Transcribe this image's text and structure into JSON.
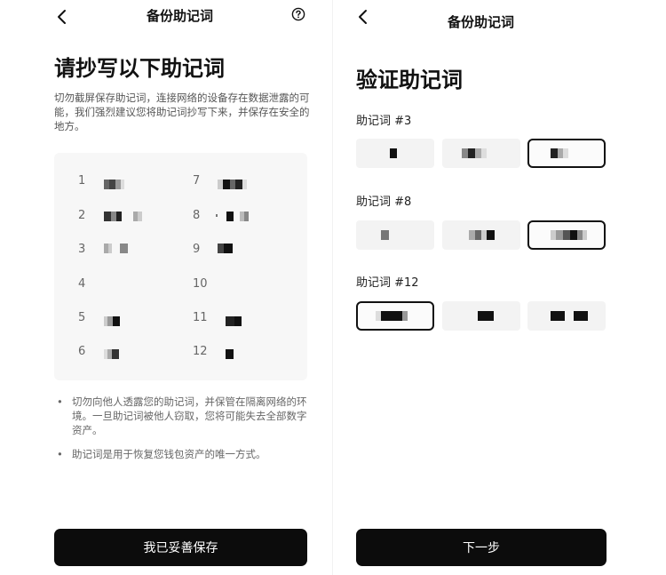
{
  "left": {
    "nav": {
      "title": "备份助记词"
    },
    "title": "请抄写以下助记词",
    "warning": "切勿截屏保存助记词，连接网络的设备存在数据泄露的可能，我们强烈建议您将助记词抄写下来，并保存在安全的地方。",
    "word_numbers": [
      "1",
      "2",
      "3",
      "4",
      "5",
      "6",
      "7",
      "8",
      "9",
      "10",
      "11",
      "12"
    ],
    "bullets": [
      "切勿向他人透露您的助记词，并保管在隔离网络的环境。一旦助记词被他人窃取，您将可能失去全部数字资产。",
      "助记词是用于恢复您钱包资产的唯一方式。"
    ],
    "bullet_symbol": "•",
    "button": "我已妥善保存"
  },
  "right": {
    "nav": {
      "title": "备份助记词"
    },
    "title": "验证助记词",
    "sections": [
      {
        "label": "助记词 #3",
        "selected_option": 3
      },
      {
        "label": "助记词 #8",
        "selected_option": 3
      },
      {
        "label": "助记词 #12",
        "selected_option": 1
      }
    ],
    "button": "下一步"
  },
  "colors": {
    "button_bg": "#0c0c0c",
    "grid_bg": "#f7f7f7",
    "option_bg": "#f3f3f3"
  },
  "icons": {
    "back": "chevron-left-icon",
    "help": "question-circle-icon"
  }
}
